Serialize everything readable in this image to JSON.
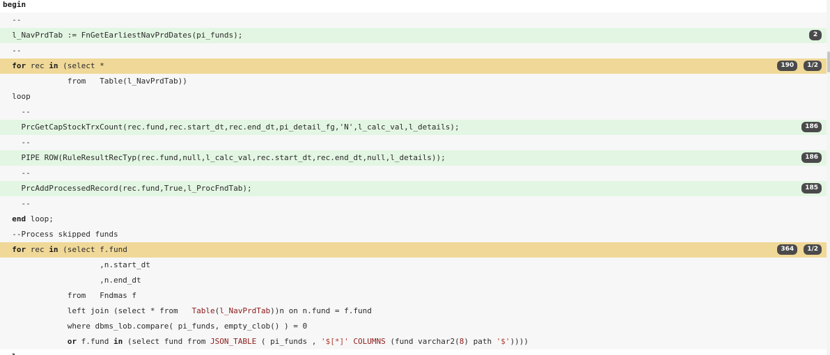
{
  "code_lines": [
    {
      "tokens": [
        {
          "t": "begin",
          "c": "kw"
        }
      ],
      "bg": "white",
      "indent": 0
    },
    {
      "tokens": [
        {
          "t": "  --"
        }
      ],
      "bg": "plain",
      "indent": 0
    },
    {
      "tokens": [
        {
          "t": "  l_NavPrdTab := FnGetEarliestNavPrdDates(pi_funds);"
        }
      ],
      "bg": "covered",
      "badges": [
        "2"
      ],
      "indent": 0
    },
    {
      "tokens": [
        {
          "t": "  --"
        }
      ],
      "bg": "plain",
      "indent": 0
    },
    {
      "tokens": [
        {
          "t": "  "
        },
        {
          "t": "for",
          "c": "kw"
        },
        {
          "t": " rec "
        },
        {
          "t": "in",
          "c": "kw"
        },
        {
          "t": " (select *"
        }
      ],
      "bg": "partial",
      "badges": [
        "190",
        "1/2"
      ],
      "indent": 0
    },
    {
      "tokens": [
        {
          "t": "              from   Table(l_NavPrdTab))"
        }
      ],
      "bg": "plain",
      "indent": 0
    },
    {
      "tokens": [
        {
          "t": "  loop"
        }
      ],
      "bg": "plain",
      "indent": 0
    },
    {
      "tokens": [
        {
          "t": "    --"
        }
      ],
      "bg": "plain",
      "indent": 0
    },
    {
      "tokens": [
        {
          "t": "    PrcGetCapStockTrxCount(rec.fund,rec.start_dt,rec.end_dt,pi_detail_fg,'N',l_calc_val,l_details);"
        }
      ],
      "bg": "covered",
      "badges": [
        "186"
      ],
      "indent": 0
    },
    {
      "tokens": [
        {
          "t": "    --"
        }
      ],
      "bg": "plain",
      "indent": 0
    },
    {
      "tokens": [
        {
          "t": "    PIPE ROW(RuleResultRecTyp(rec.fund,null,l_calc_val,rec.start_dt,rec.end_dt,null,l_details));"
        }
      ],
      "bg": "covered",
      "badges": [
        "186"
      ],
      "indent": 0
    },
    {
      "tokens": [
        {
          "t": "    --"
        }
      ],
      "bg": "plain",
      "indent": 0
    },
    {
      "tokens": [
        {
          "t": "    PrcAddProcessedRecord(rec.fund,True,l_ProcFndTab);"
        }
      ],
      "bg": "covered",
      "badges": [
        "185"
      ],
      "indent": 0
    },
    {
      "tokens": [
        {
          "t": "    --"
        }
      ],
      "bg": "plain",
      "indent": 0
    },
    {
      "tokens": [
        {
          "t": "  "
        },
        {
          "t": "end",
          "c": "kw"
        },
        {
          "t": " loop;"
        }
      ],
      "bg": "plain",
      "indent": 0
    },
    {
      "tokens": [
        {
          "t": "  --Process skipped funds"
        }
      ],
      "bg": "plain",
      "indent": 0
    },
    {
      "tokens": [
        {
          "t": "  "
        },
        {
          "t": "for",
          "c": "kw"
        },
        {
          "t": " rec "
        },
        {
          "t": "in",
          "c": "kw"
        },
        {
          "t": " (select f.fund"
        }
      ],
      "bg": "partial",
      "badges": [
        "364",
        "1/2"
      ],
      "indent": 0
    },
    {
      "tokens": [
        {
          "t": "                     ,n.start_dt"
        }
      ],
      "bg": "plain",
      "indent": 0
    },
    {
      "tokens": [
        {
          "t": "                     ,n.end_dt"
        }
      ],
      "bg": "plain",
      "indent": 0
    },
    {
      "tokens": [
        {
          "t": "              from   Fndmas f"
        }
      ],
      "bg": "plain",
      "indent": 0
    },
    {
      "tokens": [
        {
          "t": "              left join (select * from   "
        },
        {
          "t": "Table",
          "c": "fn"
        },
        {
          "t": "("
        },
        {
          "t": "l_NavPrdTab",
          "c": "fn"
        },
        {
          "t": "))n on n.fund = f.fund"
        }
      ],
      "bg": "plain",
      "indent": 0
    },
    {
      "tokens": [
        {
          "t": "              where dbms_lob.compare( pi_funds, empty_clob() ) = 0"
        }
      ],
      "bg": "plain",
      "indent": 0
    },
    {
      "tokens": [
        {
          "t": "              "
        },
        {
          "t": "or",
          "c": "kw"
        },
        {
          "t": " f.fund "
        },
        {
          "t": "in",
          "c": "kw"
        },
        {
          "t": " (select fund from "
        },
        {
          "t": "JSON_TABLE",
          "c": "fn"
        },
        {
          "t": " ( pi_funds , "
        },
        {
          "t": "'$[*]'",
          "c": "str"
        },
        {
          "t": " "
        },
        {
          "t": "COLUMNS",
          "c": "fn"
        },
        {
          "t": " (fund varchar2("
        },
        {
          "t": "8",
          "c": "num"
        },
        {
          "t": ") path "
        },
        {
          "t": "'$'",
          "c": "str"
        },
        {
          "t": "))))"
        }
      ],
      "bg": "plain",
      "indent": 0
    },
    {
      "tokens": [
        {
          "t": "  "
        },
        {
          "t": "l",
          "c": "kw"
        }
      ],
      "bg": "white",
      "indent": 0
    }
  ],
  "colors": {
    "covered": "#e3f6e3",
    "partial": "#f0d898",
    "plain": "#f7f7f7",
    "badge": "#4a4a4a"
  }
}
